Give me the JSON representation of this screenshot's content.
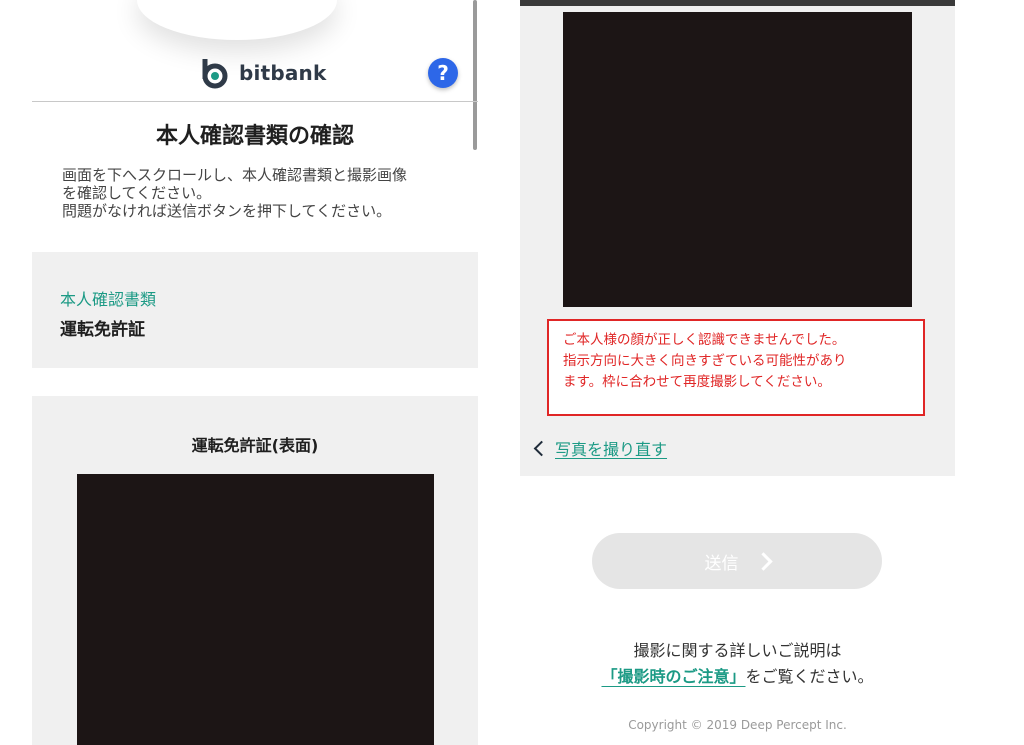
{
  "left": {
    "brand": {
      "name": "bitbank",
      "logo_icon": "bitbank-logo-icon"
    },
    "help_button": {
      "label": "?",
      "icon": "question-icon",
      "color": "#2d67e8"
    },
    "page_title": "本人確認書類の確認",
    "instructions": [
      "画面を下へスクロールし、本人確認書類と撮影画像",
      "を確認してください。",
      "問題がなければ送信ボタンを押下してください。"
    ],
    "document_type": {
      "label": "本人確認書類",
      "value": "運転免許証"
    },
    "license_card": {
      "title": "運転免許証(表面)"
    }
  },
  "right": {
    "error_message": [
      "ご本人様の顔が正しく認識できませんでした。",
      "指示方向に大きく向きすぎている可能性があり",
      "ます。枠に合わせて再度撮影してください。"
    ],
    "retake_link": "写真を撮り直す",
    "send_button": {
      "label": "送信",
      "enabled": false
    },
    "help_text": {
      "line1": "撮影に関する詳しいご説明は",
      "link": "「撮影時のご注意」",
      "line2_suffix": "をご覧ください。"
    },
    "copyright": "Copyright © 2019 Deep Percept Inc."
  },
  "colors": {
    "accent": "#1c9a85",
    "error": "#e02626",
    "card_bg": "#f0f0f0",
    "image_placeholder": "#1c1515"
  }
}
